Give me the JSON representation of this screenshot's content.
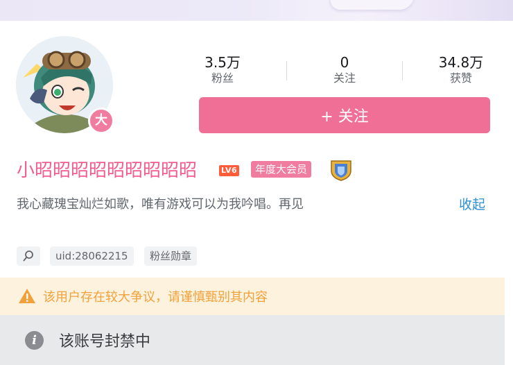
{
  "profile": {
    "name": "小昭昭昭昭昭昭昭昭昭",
    "level": "LV6",
    "vip_label": "年度大会员",
    "avatar_badge": "大",
    "signature": "我心藏瑰宝灿烂如歌，唯有游戏可以为我吟唱。再见",
    "collapse_label": "收起"
  },
  "stats": [
    {
      "value": "3.5万",
      "label": "粉丝"
    },
    {
      "value": "0",
      "label": "关注"
    },
    {
      "value": "34.8万",
      "label": "获赞"
    }
  ],
  "follow_button": "+ 关注",
  "tags": {
    "icon": "search-person-icon",
    "uid": "uid:28062215",
    "fan_medal": "粉丝勋章"
  },
  "notices": {
    "warning": "该用户存在较大争议，请谨慎甄别其内容",
    "banned": "该账号封禁中"
  },
  "colors": {
    "accent": "#f25d8e",
    "button": "#ef6f97",
    "link": "#2d8fd6",
    "warning": "#f2a13a"
  }
}
